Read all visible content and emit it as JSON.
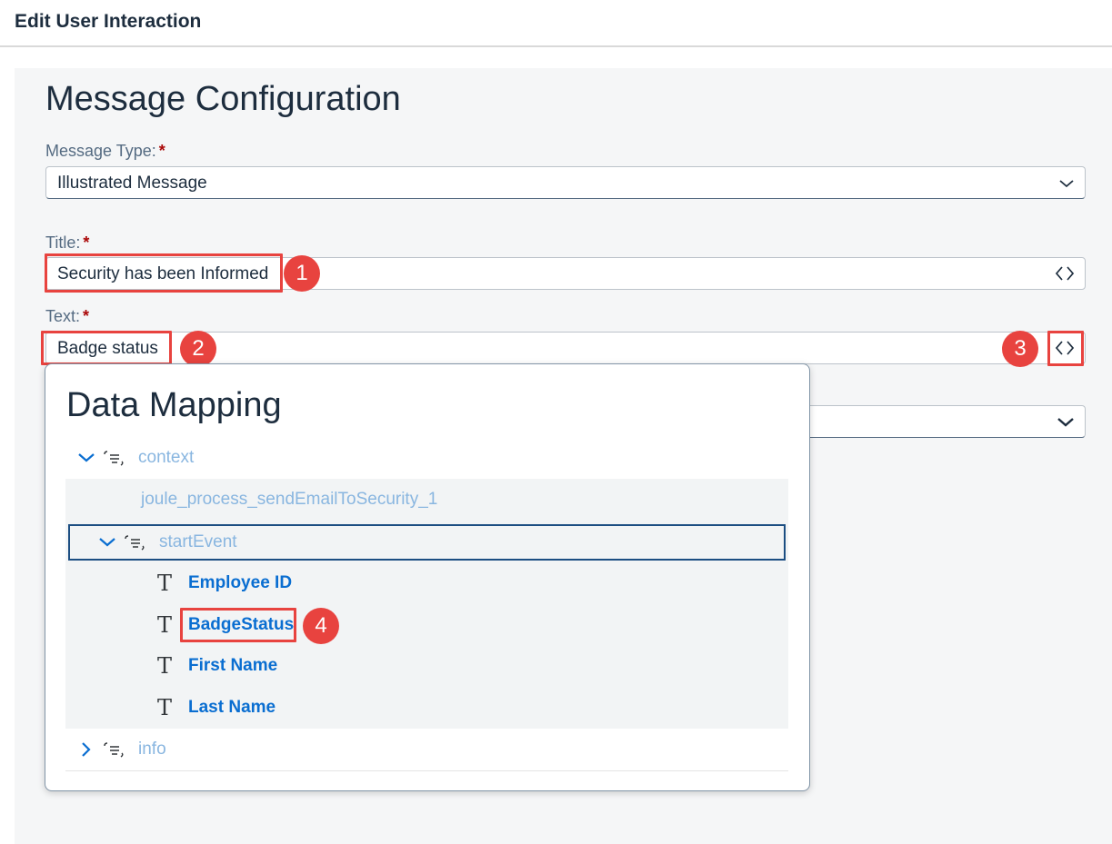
{
  "header": {
    "title": "Edit User Interaction"
  },
  "section": {
    "title": "Message Configuration"
  },
  "form": {
    "message_type": {
      "label": "Message Type:",
      "required": "*",
      "value": "Illustrated Message"
    },
    "title": {
      "label": "Title:",
      "required": "*",
      "value": "Security has been Informed"
    },
    "text": {
      "label": "Text:",
      "required": "*",
      "value": "Badge status"
    }
  },
  "callouts": [
    "1",
    "2",
    "3",
    "4"
  ],
  "data_mapping": {
    "title": "Data Mapping",
    "tree": {
      "context": {
        "label": "context",
        "icon": "structure-icon",
        "expanded": true
      },
      "process": {
        "label": "joule_process_sendEmailToSecurity_1"
      },
      "start_event": {
        "label": "startEvent",
        "icon": "structure-icon",
        "expanded": true
      },
      "fields": [
        {
          "label": "Employee ID",
          "icon": "text-type-icon"
        },
        {
          "label": "BadgeStatus",
          "icon": "text-type-icon"
        },
        {
          "label": "First Name",
          "icon": "text-type-icon"
        },
        {
          "label": "Last Name",
          "icon": "text-type-icon"
        }
      ],
      "info": {
        "label": "info",
        "icon": "structure-icon",
        "expanded": false
      }
    }
  },
  "colors": {
    "accent": "#0a6ed1",
    "highlight": "#e8433f",
    "required": "#aa0808"
  }
}
